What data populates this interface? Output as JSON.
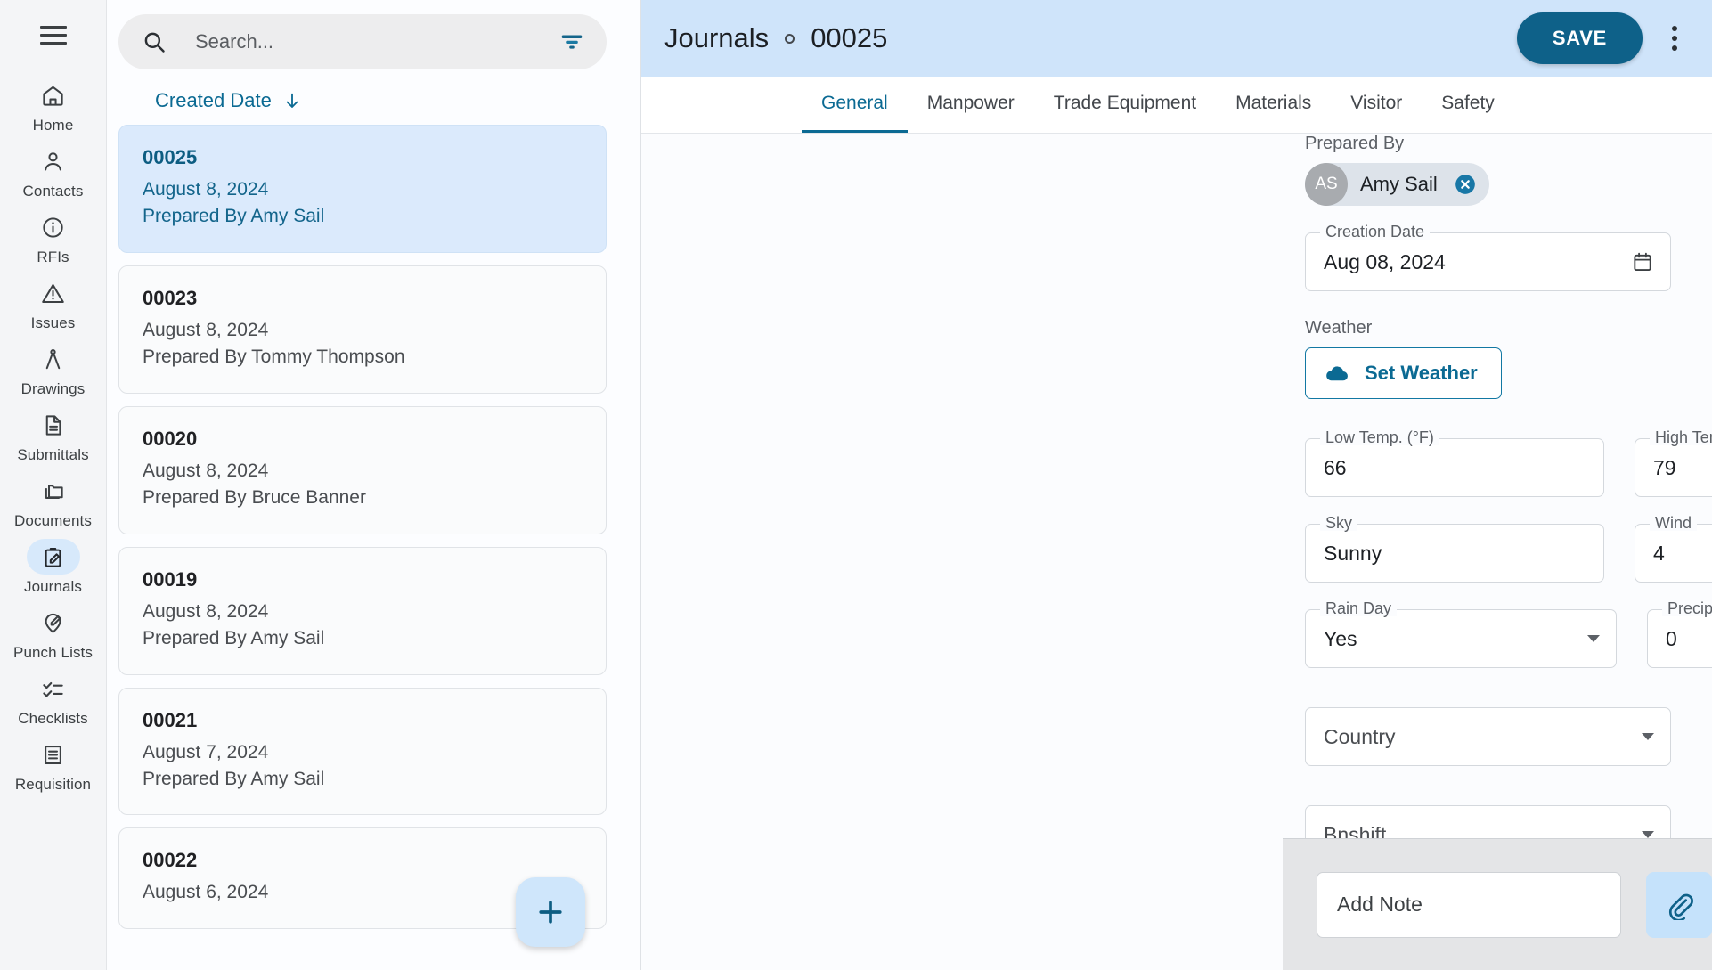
{
  "sidebar": {
    "menu_icon": "hamburger-menu-icon",
    "items": [
      {
        "label": "Home",
        "icon": "home-icon",
        "active": false
      },
      {
        "label": "Contacts",
        "icon": "person-icon",
        "active": false
      },
      {
        "label": "RFIs",
        "icon": "info-circle-icon",
        "active": false
      },
      {
        "label": "Issues",
        "icon": "warning-triangle-icon",
        "active": false
      },
      {
        "label": "Drawings",
        "icon": "compass-icon",
        "active": false
      },
      {
        "label": "Submittals",
        "icon": "document-icon",
        "active": false
      },
      {
        "label": "Documents",
        "icon": "folders-icon",
        "active": false
      },
      {
        "label": "Journals",
        "icon": "clipboard-pencil-icon",
        "active": true
      },
      {
        "label": "Punch Lists",
        "icon": "pin-pencil-icon",
        "active": false
      },
      {
        "label": "Checklists",
        "icon": "checklist-icon",
        "active": false
      },
      {
        "label": "Requisition",
        "icon": "receipt-icon",
        "active": false
      }
    ]
  },
  "list": {
    "search": {
      "placeholder": "Search...",
      "value": "",
      "icon": "search-icon"
    },
    "filter_icon": "filter-funnel-icon",
    "sort": {
      "label": "Created Date",
      "direction_icon": "arrow-down-icon"
    },
    "add_button": {
      "icon": "plus-icon",
      "label": ""
    },
    "cards": [
      {
        "id": "00025",
        "date": "August 8, 2024",
        "prepared_by": "Prepared By Amy Sail",
        "selected": true
      },
      {
        "id": "00023",
        "date": "August 8, 2024",
        "prepared_by": "Prepared By Tommy Thompson",
        "selected": false
      },
      {
        "id": "00020",
        "date": "August 8, 2024",
        "prepared_by": "Prepared By Bruce Banner",
        "selected": false
      },
      {
        "id": "00019",
        "date": "August 8, 2024",
        "prepared_by": "Prepared By Amy Sail",
        "selected": false
      },
      {
        "id": "00021",
        "date": "August 7, 2024",
        "prepared_by": "Prepared By Amy Sail",
        "selected": false
      },
      {
        "id": "00022",
        "date": "August 6, 2024",
        "prepared_by": "",
        "selected": false
      }
    ]
  },
  "detail": {
    "breadcrumb_root": "Journals",
    "breadcrumb_id": "00025",
    "save_label": "SAVE",
    "menu_icon": "more-vertical-icon",
    "tabs": [
      {
        "label": "General",
        "active": true
      },
      {
        "label": "Manpower",
        "active": false
      },
      {
        "label": "Trade Equipment",
        "active": false
      },
      {
        "label": "Materials",
        "active": false
      },
      {
        "label": "Visitor",
        "active": false
      },
      {
        "label": "Safety",
        "active": false
      }
    ],
    "form": {
      "prepared_by_label": "Prepared By",
      "prepared_by_chip": {
        "initials": "AS",
        "name": "Amy Sail",
        "remove_icon": "close-circle-icon"
      },
      "creation_date": {
        "label": "Creation Date",
        "value": "Aug 08, 2024",
        "icon": "calendar-icon"
      },
      "weather_label": "Weather",
      "set_weather_button": {
        "label": "Set Weather",
        "icon": "cloud-icon"
      },
      "low_temp": {
        "label": "Low Temp. (°F)",
        "value": "66"
      },
      "high_temp": {
        "label": "High Temp. (°F)",
        "value": "79"
      },
      "sky": {
        "label": "Sky",
        "value": "Sunny"
      },
      "wind": {
        "label": "Wind",
        "value": "4"
      },
      "rain_day": {
        "label": "Rain Day",
        "value": "Yes"
      },
      "precipitation": {
        "label": "Precipitation",
        "value": "0"
      },
      "country": {
        "placeholder": "Country",
        "value": ""
      },
      "shift": {
        "placeholder": "Bnshift",
        "value": ""
      }
    },
    "note_bar": {
      "placeholder": "Add Note",
      "value": "",
      "attach_icon": "paperclip-icon",
      "camera_icon": "camera-icon"
    }
  },
  "colors": {
    "accent": "#0b6a93",
    "save_button": "#0e6189",
    "header_bg": "#cfe4fa",
    "selected_card": "#dbeafc",
    "icon_button_bg": "#c5e2fb"
  }
}
